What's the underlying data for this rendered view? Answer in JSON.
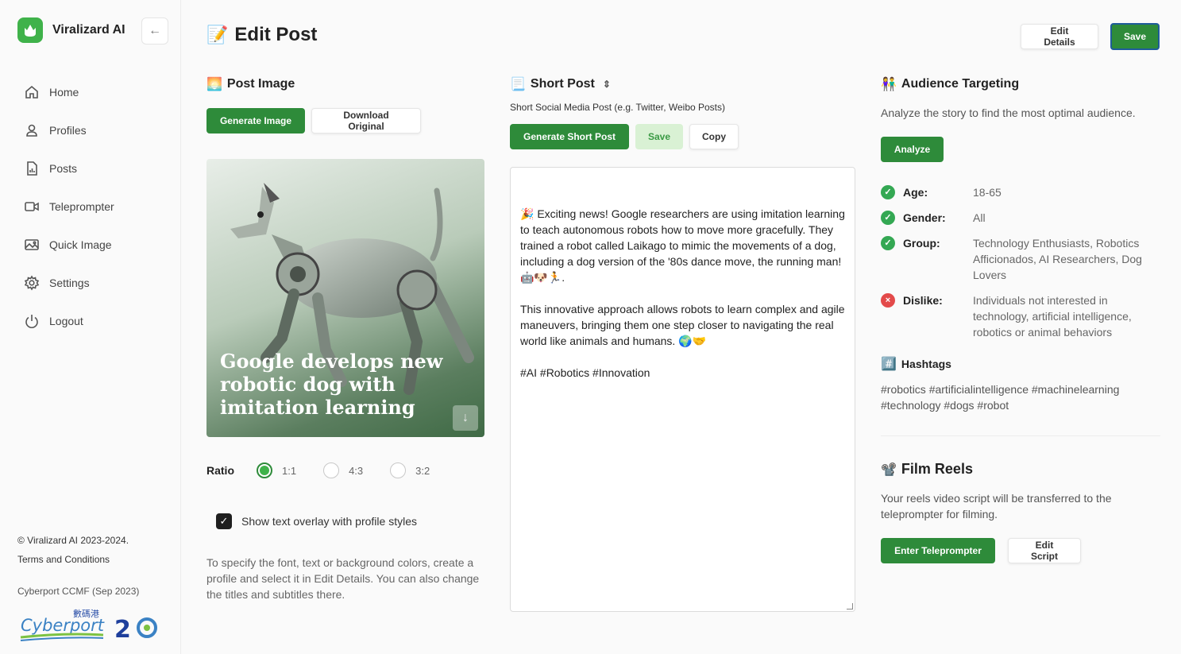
{
  "sidebar": {
    "brand": "Viralizard AI",
    "items": [
      {
        "label": "Home",
        "icon": "home-icon"
      },
      {
        "label": "Profiles",
        "icon": "user-icon"
      },
      {
        "label": "Posts",
        "icon": "document-icon"
      },
      {
        "label": "Teleprompter",
        "icon": "video-camera-icon"
      },
      {
        "label": "Quick Image",
        "icon": "image-icon"
      },
      {
        "label": "Settings",
        "icon": "gear-icon"
      },
      {
        "label": "Logout",
        "icon": "power-icon"
      }
    ],
    "footer": {
      "copyright": "© Viralizard AI 2023-2024.",
      "terms": "Terms and Conditions",
      "program": "Cyberport CCMF (Sep 2023)",
      "partner_logo": "Cyberport 數碼港 2O"
    }
  },
  "header": {
    "title": "Edit Post",
    "title_emoji": "📝",
    "edit_details": "Edit Details",
    "save": "Save"
  },
  "post_image": {
    "title": "Post Image",
    "title_emoji": "🌅",
    "generate": "Generate Image",
    "download": "Download Original",
    "overlay": "Google develops new robotic dog with imitation learning",
    "ratio_label": "Ratio",
    "ratios": [
      "1:1",
      "4:3",
      "3:2"
    ],
    "selected_ratio": "1:1",
    "overlay_checkbox": "Show text overlay with profile styles",
    "help": "To specify the font, text or background colors, create a profile and select it in Edit Details. You can also change the titles and subtitles there."
  },
  "short_post": {
    "title": "Short Post",
    "title_emoji": "📃",
    "subtitle": "Short Social Media Post (e.g. Twitter, Weibo Posts)",
    "generate": "Generate Short Post",
    "save": "Save",
    "copy": "Copy",
    "text": "🎉 Exciting news! Google researchers are using imitation learning to teach autonomous robots how to move more gracefully. They trained a robot called Laikago to mimic the movements of a dog, including a dog version of the '80s dance move, the running man! 🤖🐶🏃.\n\nThis innovative approach allows robots to learn complex and agile maneuvers, bringing them one step closer to navigating the real world like animals and humans. 🌍🤝\n\n#AI #Robotics #Innovation"
  },
  "audience": {
    "title": "Audience Targeting",
    "title_emoji": "👫",
    "description": "Analyze the story to find the most optimal audience.",
    "analyze": "Analyze",
    "items": [
      {
        "key": "Age:",
        "value": "18-65",
        "status": "ok"
      },
      {
        "key": "Gender:",
        "value": "All",
        "status": "ok"
      },
      {
        "key": "Group:",
        "value": "Technology Enthusiasts, Robotics Afficionados, AI Researchers, Dog Lovers",
        "status": "ok"
      },
      {
        "key": "Dislike:",
        "value": "Individuals not interested in technology, artificial intelligence, robotics or animal behaviors",
        "status": "no"
      }
    ],
    "hashtags_title": "Hashtags",
    "hashtags_emoji": "#️⃣",
    "hashtags": "#robotics #artificialintelligence #machinelearning #technology #dogs #robot"
  },
  "film_reels": {
    "title": "Film Reels",
    "title_emoji": "📽️",
    "description": "Your reels video script will be transferred to the teleprompter for filming.",
    "enter": "Enter Teleprompter",
    "edit": "Edit Script"
  },
  "colors": {
    "primary": "#2e8b3a",
    "accent": "#3fb24a",
    "save_light": "#d9f1d4",
    "danger": "#e34a4a"
  }
}
